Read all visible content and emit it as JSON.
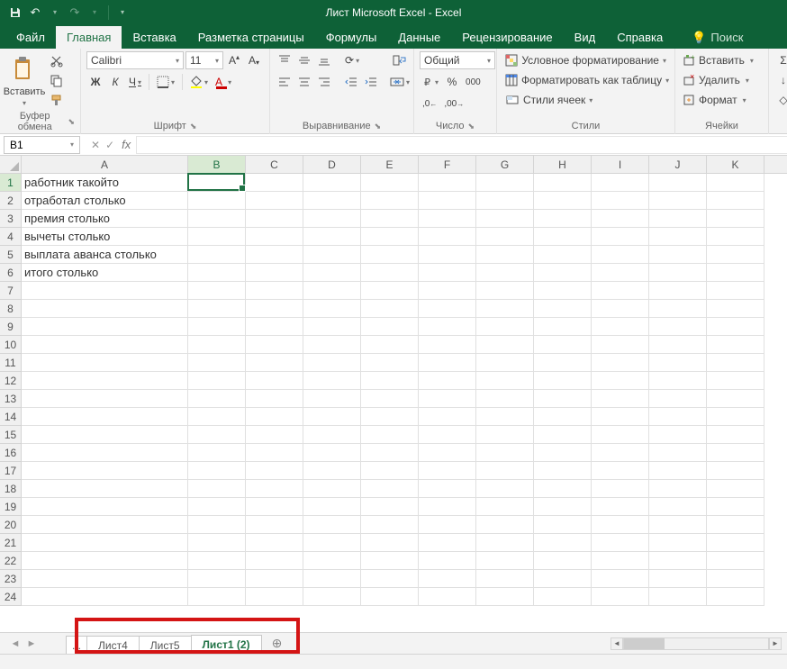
{
  "title": "Лист Microsoft Excel  -  Excel",
  "menu": {
    "file": "Файл",
    "home": "Главная",
    "insert": "Вставка",
    "layout": "Разметка страницы",
    "formulas": "Формулы",
    "data": "Данные",
    "review": "Рецензирование",
    "view": "Вид",
    "help": "Справка",
    "tellme": "Поиск"
  },
  "ribbon": {
    "clipboard": {
      "label": "Буфер обмена",
      "paste": "Вставить"
    },
    "font": {
      "label": "Шрифт",
      "name": "Calibri",
      "size": "11"
    },
    "alignment": {
      "label": "Выравнивание"
    },
    "number": {
      "label": "Число",
      "format": "Общий"
    },
    "styles": {
      "label": "Стили",
      "cond": "Условное форматирование",
      "table": "Форматировать как таблицу",
      "cell": "Стили ячеек"
    },
    "cells": {
      "label": "Ячейки",
      "insert": "Вставить",
      "delete": "Удалить",
      "format": "Формат"
    }
  },
  "namebox": "B1",
  "columns": [
    "A",
    "B",
    "C",
    "D",
    "E",
    "F",
    "G",
    "H",
    "I",
    "J",
    "K"
  ],
  "rowData": [
    "работник такойто",
    "отработал столько",
    "премия столько",
    "вычеты столько",
    "выплата аванса столько",
    "итого столько"
  ],
  "rowCount": 24,
  "sheets": {
    "dots": ". .",
    "s1": "Лист4",
    "s2": "Лист5",
    "active": "Лист1 (2)"
  }
}
